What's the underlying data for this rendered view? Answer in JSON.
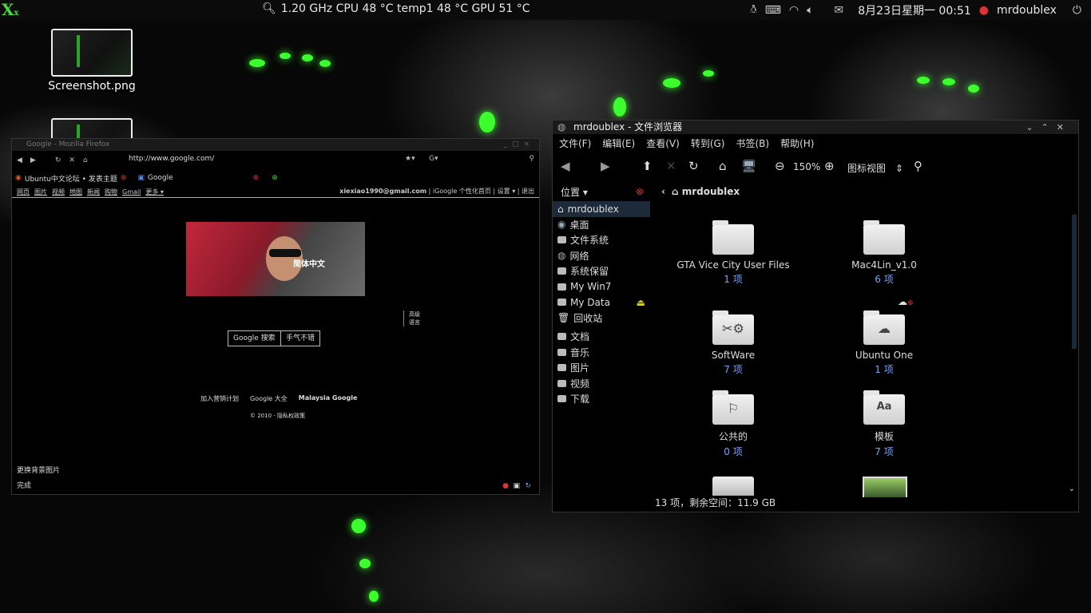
{
  "top_panel": {
    "sensors": "1.20 GHz CPU 48 °C temp1 48 °C GPU 51 °C",
    "datetime": "8月23日星期一 00:51",
    "username": "mrdoublex"
  },
  "desktop": {
    "icons": [
      {
        "label": "Screenshot.png"
      }
    ]
  },
  "firefox": {
    "title": "Google - Mozilla Firefox",
    "url": "http://www.google.com/",
    "tabs": [
      {
        "label": "Ubuntu中文论坛 • 发表主题"
      },
      {
        "label": "Google"
      }
    ],
    "google_bar": {
      "links": [
        "网页",
        "图片",
        "视频",
        "地图",
        "新闻",
        "购物",
        "Gmail",
        "更多 ▾"
      ],
      "email": "xiexiao1990@gmail.com",
      "right_links": "| iGoogle 个性化首页 | 设置 ▾ | 退出"
    },
    "doodle_text": "简体中文",
    "side_links": [
      "高级",
      "语言"
    ],
    "buttons": {
      "search": "Google 搜索",
      "lucky": "手气不错"
    },
    "footer_links": [
      "加入营销计划",
      "Google 大全",
      "Malaysia Google"
    ],
    "copyright": "© 2010 - 隐私权政策",
    "change_bg": "更换背景图片",
    "status": "完成"
  },
  "file_manager": {
    "title": "mrdoublex - 文件浏览器",
    "menu": [
      "文件(F)",
      "编辑(E)",
      "查看(V)",
      "转到(G)",
      "书签(B)",
      "帮助(H)"
    ],
    "zoom": "150%",
    "view_mode": "图标视图",
    "sidebar_header": "位置 ▾",
    "sidebar": [
      {
        "label": "mrdoublex",
        "selected": true
      },
      {
        "label": "桌面"
      },
      {
        "label": "文件系统"
      },
      {
        "label": "网络"
      },
      {
        "label": "系统保留"
      },
      {
        "label": "My Win7"
      },
      {
        "label": "My Data"
      },
      {
        "label": "回收站"
      },
      {
        "label": "文档"
      },
      {
        "label": "音乐"
      },
      {
        "label": "图片"
      },
      {
        "label": "视频"
      },
      {
        "label": "下载"
      }
    ],
    "breadcrumb": "mrdoublex",
    "items": [
      {
        "name": "GTA Vice City User Files",
        "count": "1 项",
        "icon": "folder-icon"
      },
      {
        "name": "Mac4Lin_v1.0",
        "count": "6 项",
        "icon": "folder-icon"
      },
      {
        "name": "SoftWare",
        "count": "7 项",
        "icon": "tools-folder-icon"
      },
      {
        "name": "Ubuntu One",
        "count": "1 项",
        "icon": "cloud-folder-icon"
      },
      {
        "name": "公共的",
        "count": "0 项",
        "icon": "share-folder-icon"
      },
      {
        "name": "模板",
        "count": "7 项",
        "icon": "template-folder-icon"
      }
    ],
    "status": "13 项，剩余空间：11.9 GB"
  }
}
